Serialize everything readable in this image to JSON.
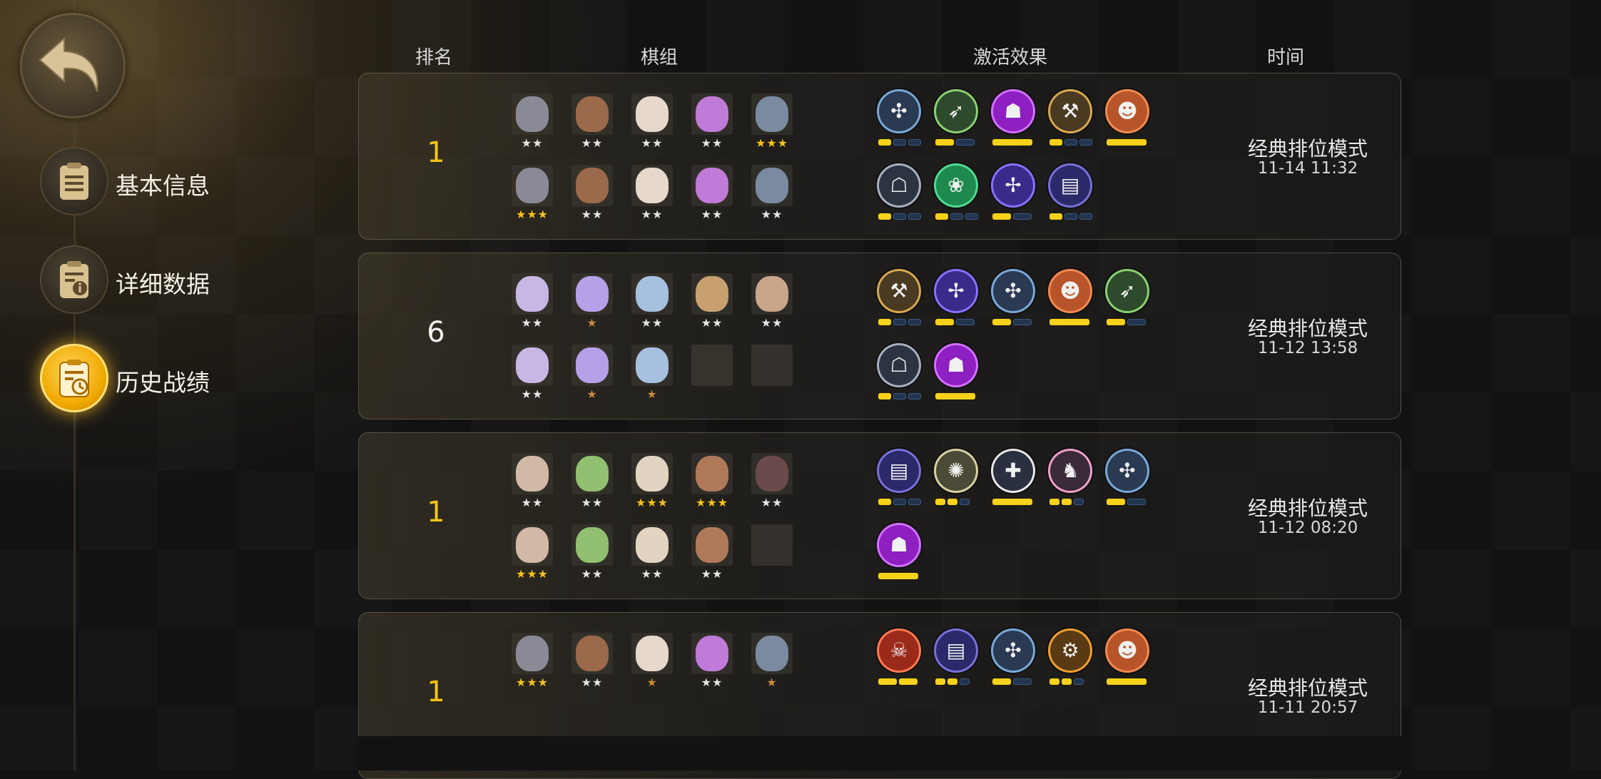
{
  "nav": {
    "items": [
      {
        "label": "基本信息",
        "active": false,
        "icon": "clipboard-icon"
      },
      {
        "label": "详细数据",
        "active": false,
        "icon": "clipboard-info-icon"
      },
      {
        "label": "历史战绩",
        "active": true,
        "icon": "clipboard-clock-icon"
      }
    ]
  },
  "headers": {
    "rank": "排名",
    "lineup": "棋组",
    "effects": "激活效果",
    "time": "时间"
  },
  "colors": {
    "accent_gold": "#f5c419",
    "bar_on": "#f7d21a",
    "bar_off": "#22344e"
  },
  "matches": [
    {
      "rank": "1",
      "mode": "经典排位模式",
      "time": "11-14 11:32",
      "pieces": [
        "★★",
        "★★",
        "★★",
        "★★",
        "★★★",
        "★★★",
        "★★",
        "★★",
        "★★",
        "★★"
      ],
      "traits": [
        {
          "icon": "blue-swirl-icon",
          "bars": "1/3"
        },
        {
          "icon": "green-bow-icon",
          "bars": "1/2"
        },
        {
          "icon": "purple-demon-icon",
          "bars": "full"
        },
        {
          "icon": "gold-axe-icon",
          "bars": "1/3"
        },
        {
          "icon": "orange-viking-icon",
          "bars": "full"
        },
        {
          "icon": "grey-helm-icon",
          "bars": "1/3"
        },
        {
          "icon": "green-paw-icon",
          "bars": "1/3"
        },
        {
          "icon": "purple-fishbone-icon",
          "bars": "1/2"
        },
        {
          "icon": "purple-tablet-icon",
          "bars": "1/3"
        }
      ]
    },
    {
      "rank": "6",
      "mode": "经典排位模式",
      "time": "11-12 13:58",
      "pieces": [
        "★★",
        "★",
        "★★",
        "★★",
        "★★",
        "★★",
        "★",
        "★"
      ],
      "traits": [
        {
          "icon": "gold-axe-icon",
          "bars": "1/3"
        },
        {
          "icon": "purple-fishbone-icon",
          "bars": "1/2"
        },
        {
          "icon": "blue-swirl-icon",
          "bars": "1/2"
        },
        {
          "icon": "orange-viking-icon",
          "bars": "full"
        },
        {
          "icon": "green-bow-icon",
          "bars": "1/2"
        },
        {
          "icon": "grey-helm-icon",
          "bars": "1/3"
        },
        {
          "icon": "purple-demon-icon",
          "bars": "full"
        }
      ]
    },
    {
      "rank": "1",
      "mode": "经典排位模式",
      "time": "11-12 08:20",
      "pieces": [
        "★★",
        "★★",
        "★★★",
        "★★★",
        "★★",
        "★★★",
        "★★",
        "★★",
        "★★"
      ],
      "traits": [
        {
          "icon": "purple-tablet-icon",
          "bars": "1/3"
        },
        {
          "icon": "tan-bird-icon",
          "bars": "2/3"
        },
        {
          "icon": "white-cross-icon",
          "bars": "full"
        },
        {
          "icon": "pink-knight-icon",
          "bars": "2/3"
        },
        {
          "icon": "blue-swirl-icon",
          "bars": "1/2"
        },
        {
          "icon": "purple-demon-icon",
          "bars": "full"
        }
      ]
    },
    {
      "rank": "1",
      "mode": "经典排位模式",
      "time": "11-11 20:57",
      "pieces": [
        "★★★",
        "★★",
        "★",
        "★★",
        "★"
      ],
      "traits": [
        {
          "icon": "red-demon-icon",
          "bars": "2/2"
        },
        {
          "icon": "purple-tablet-icon",
          "bars": "2/3"
        },
        {
          "icon": "blue-swirl-icon",
          "bars": "1/2"
        },
        {
          "icon": "gold-gear-icon",
          "bars": "2/3"
        },
        {
          "icon": "orange-viking-icon",
          "bars": "full"
        }
      ]
    }
  ]
}
